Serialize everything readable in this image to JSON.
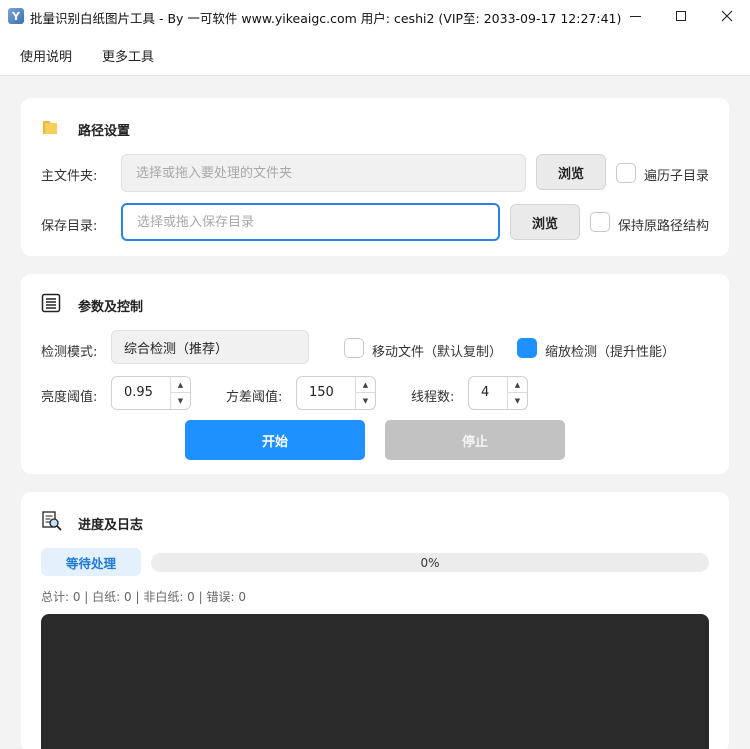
{
  "window": {
    "title": "批量识别白纸图片工具 - By 一可软件 www.yikeaigc.com 用户: ceshi2 (VIP至: 2033-09-17 12:27:41)",
    "icon": "app-icon"
  },
  "menu": {
    "items": [
      "使用说明",
      "更多工具"
    ]
  },
  "path_section": {
    "title": "路径设置",
    "icon": "folder-icon",
    "main_folder_label": "主文件夹:",
    "main_folder_placeholder": "选择或拖入要处理的文件夹",
    "main_folder_value": "",
    "browse_label": "浏览",
    "traverse_subdirs_label": "遍历子目录",
    "traverse_subdirs_checked": false,
    "save_dir_label": "保存目录:",
    "save_dir_placeholder": "选择或拖入保存目录",
    "save_dir_value": "",
    "keep_structure_label": "保持原路径结构",
    "keep_structure_checked": false
  },
  "param_section": {
    "title": "参数及控制",
    "icon": "list-icon",
    "mode_label": "检测模式:",
    "mode_value": "综合检测（推荐）",
    "move_files_label": "移动文件（默认复制）",
    "move_files_checked": false,
    "scale_detect_label": "缩放检测（提升性能）",
    "scale_detect_checked": true,
    "brightness_label": "亮度阈值:",
    "brightness_value": "0.95",
    "variance_label": "方差阈值:",
    "variance_value": "150",
    "threads_label": "线程数:",
    "threads_value": "4",
    "start_label": "开始",
    "stop_label": "停止",
    "accent_color": "#1e90ff"
  },
  "log_section": {
    "title": "进度及日志",
    "icon": "log-search-icon",
    "status": "等待处理",
    "progress_percent": 0,
    "progress_text": "0%",
    "stats": "总计: 0 | 白纸: 0 | 非白纸: 0 | 错误: 0"
  }
}
